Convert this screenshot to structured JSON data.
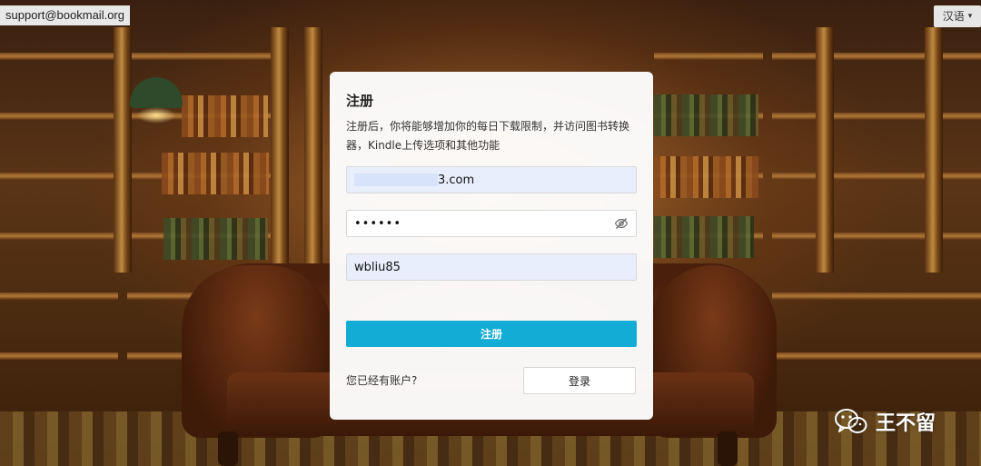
{
  "account_email": "support@bookmail.org",
  "language": {
    "label": "汉语",
    "caret": "▾"
  },
  "register": {
    "title": "注册",
    "description": "注册后，你将能够增加你的每日下载限制，并访问图书转换器，Kindle上传选项和其他功能",
    "email_value_suffix": "3.com",
    "password_value": "••••••",
    "name_value": "wbliu85",
    "submit_label": "注册",
    "has_account_text": "您已经有账户?",
    "login_label": "登录"
  },
  "watermark": {
    "text": "王不留",
    "icon": "wechat-icon"
  },
  "colors": {
    "primary_button": "#12acd4",
    "filled_field": "#e8eefc"
  }
}
